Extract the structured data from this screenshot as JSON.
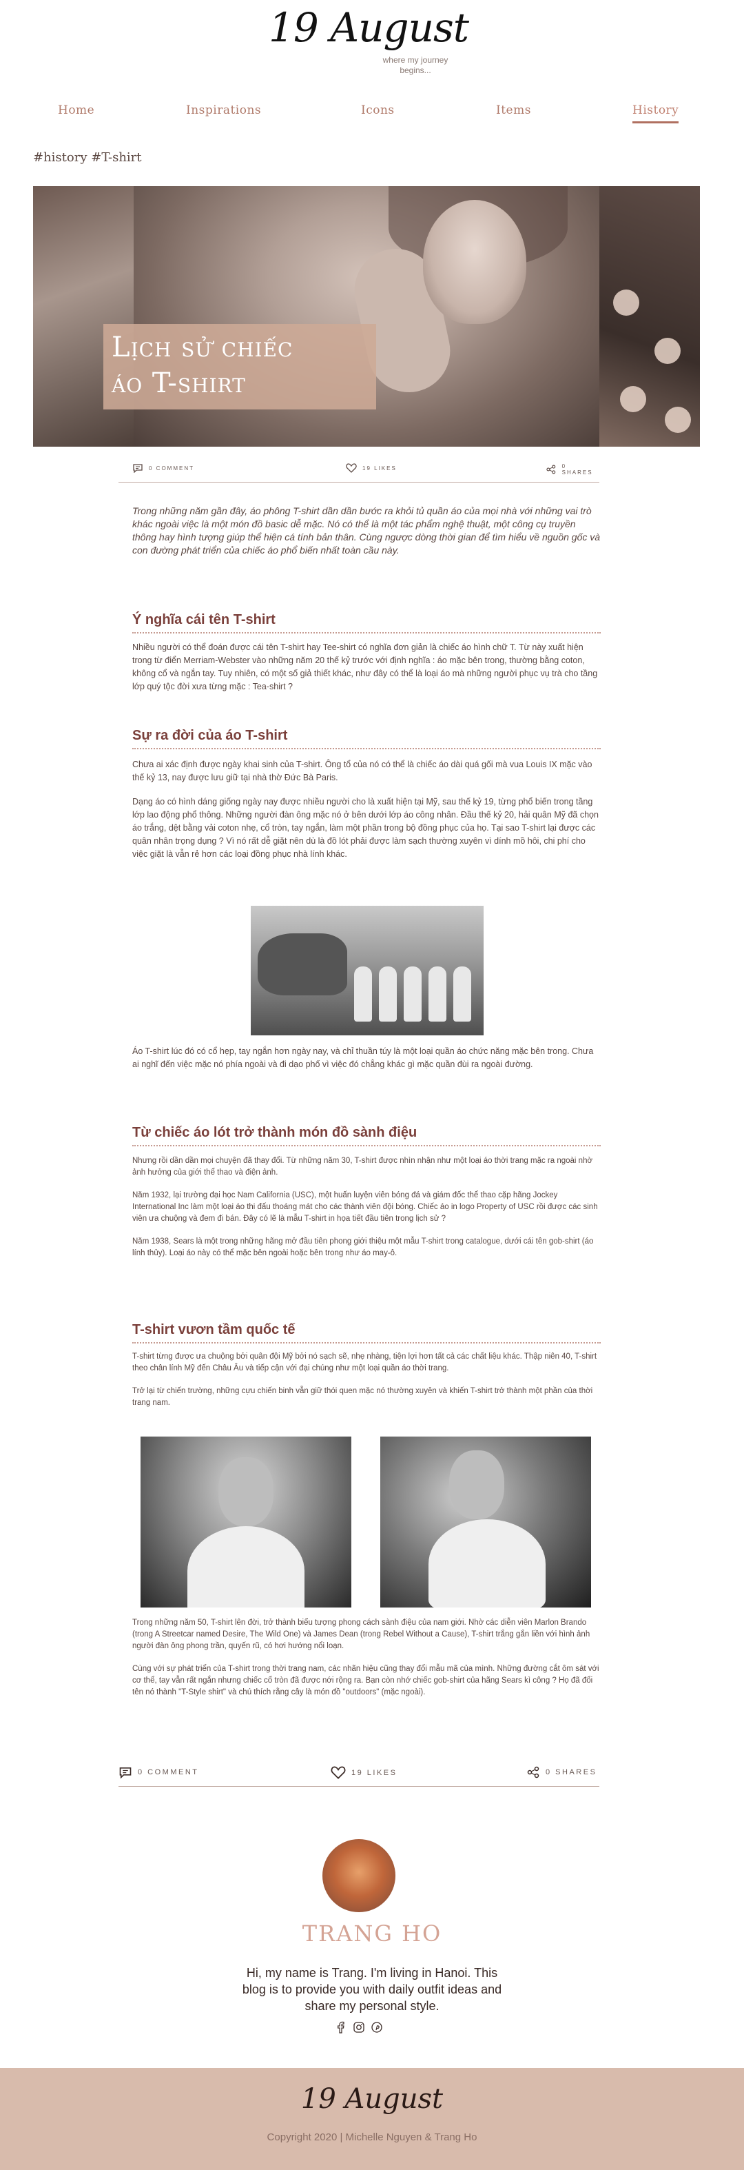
{
  "header": {
    "logo": "19 August",
    "tagline": "where my journey begins..."
  },
  "nav": {
    "items": [
      "Home",
      "Inspirations",
      "Icons",
      "Items",
      "History"
    ],
    "active": "History"
  },
  "tags": "#history #T-shirt",
  "hero": {
    "title_line1": "Lịch sử chiếc",
    "title_line2": "áo T-shirt"
  },
  "meta": {
    "comments": "0 COMMENT",
    "likes": "19 LIKES",
    "shares": "0 SHARES"
  },
  "article": {
    "intro": "Trong những năm gần đây, áo phông T-shirt dần dần bước ra khỏi tủ quần áo của mọi nhà với những vai trò khác ngoài việc là một món đồ basic dễ mặc. Nó có thể là một tác phẩm nghệ thuật, một công cụ truyền thông hay hình tượng giúp thể hiện cá tính bản thân. Cùng ngược dòng thời gian để tìm hiểu về nguồn gốc và con đường phát triển của chiếc áo phổ biến nhất toàn cầu này.",
    "section1": {
      "heading": "Ý nghĩa cái tên T-shirt",
      "p1": "Nhiều người có thể đoán được cái tên T-shirt hay Tee-shirt có nghĩa đơn giản là chiếc áo hình chữ T. Từ này xuất hiện trong từ điển Merriam-Webster vào những năm 20 thế kỷ trước với định nghĩa : áo mặc bên trong, thường bằng coton, không cổ và ngắn tay. Tuy nhiên, có một số giả thiết khác, như đây có thể là loại áo mà những người phục vụ trà cho tầng lớp quý tộc đời xưa từng mặc : Tea-shirt ?"
    },
    "section2": {
      "heading": "Sự ra đời của áo T-shirt",
      "p1": "Chưa ai xác định được ngày khai sinh của T-shirt. Ông tổ của nó có thể là chiếc áo dài quá gối mà vua Louis IX mặc vào thế kỷ 13, nay được lưu giữ tại nhà thờ Đức Bà Paris.",
      "p2": "Dạng áo có hình dáng giống ngày nay được nhiều người cho là xuất hiện tại Mỹ, sau thế kỷ 19, từng phổ biến trong tầng lớp lao động phổ thông. Những người đàn ông mặc nó ở bên dưới lớp áo công nhân. Đầu thế kỷ 20, hải quân Mỹ đã chọn áo trắng, dệt bằng vải coton nhẹ, cổ tròn, tay ngắn, làm một phần trong bộ đồng phục của họ. Tại sao T-shirt lại được các quân nhân trọng dụng ? Vì nó rất dễ giặt nên dù là đồ lót phải được làm sạch thường xuyên vì dính mồ hôi, chi phí cho việc giặt là vẫn rẻ hơn các loại đồng phục nhà lính khác.",
      "p3": "Áo T-shirt lúc đó có cổ hẹp, tay ngắn hơn ngày nay, và chỉ thuần túy là một loại quần áo chức năng mặc bên trong. Chưa ai nghĩ đến việc mặc nó phía ngoài và đi dạo phố vì việc đó chẳng khác gì mặc quần đùi ra ngoài đường."
    },
    "section3": {
      "heading": "Từ chiếc áo lót trở thành món đồ sành điệu",
      "p1": "Nhưng rồi dần dần mọi chuyện đã thay đổi. Từ những năm 30, T-shirt được nhìn nhận như một loại áo thời trang mặc ra ngoài nhờ ảnh hưởng của giới thể thao và điện ảnh.",
      "p2": "Năm 1932, lại trường đại học Nam California (USC), một huấn luyện viên bóng đá và giám đốc thể thao cặp hãng Jockey International Inc làm một loại áo thi đấu thoáng mát cho các thành viên đội bóng. Chiếc áo in logo Property of USC rồi được các sinh viên ưa chuộng và đem đi bán. Đây có lẽ là mẫu T-shirt in họa tiết đầu tiên trong lịch sử ?",
      "p3": "Năm 1938, Sears là một trong những hãng mở đầu tiên phong giới thiệu một mẫu T-shirt trong catalogue, dưới cái tên gob-shirt (áo lính thủy). Loại áo này có thể mặc bên ngoài hoặc bên trong như áo may-ô."
    },
    "section4": {
      "heading": "T-shirt vươn tầm quốc tế",
      "p1": "T-shirt từng được ưa chuộng bởi quân đội Mỹ bởi nó sạch sẽ, nhẹ nhàng, tiện lợi hơn tất cả các chất liệu khác. Thập niên 40, T-shirt theo chân lính Mỹ đến Châu Âu và tiếp cận với đại chúng như một loại quần áo thời trang.",
      "p2": "Trở lại từ chiến trường, những cựu chiến binh vẫn giữ thói quen mặc nó thường xuyên và khiến T-shirt trở thành một phần của thời trang nam.",
      "p3": "Trong những năm 50, T-shirt lên đời, trở thành biểu tượng phong cách sành điệu của nam giới. Nhờ các diễn viên Marlon Brando (trong A Streetcar named Desire, The Wild One) và James Dean (trong Rebel Without a Cause), T-shirt trắng gắn liền với hình ảnh người đàn ông phong trần, quyến rũ, có hơi hướng nổi loạn.",
      "p4": "Cùng với sự phát triển của T-shirt trong thời trang nam, các nhãn hiệu cũng thay đổi mẫu mã của mình. Những đường cắt ôm sát với cơ thể, tay vẫn rất ngắn nhưng chiếc cổ tròn đã được nới rộng ra. Bạn còn nhớ chiếc gob-shirt của hãng Sears kì công ? Họ đã đổi tên nó thành \"T-Style shirt\" và chú thích rằng cây là món đồ \"outdoors\" (mặc ngoài)."
    }
  },
  "author": {
    "name": "TRANG HO",
    "bio": "Hi, my name is Trang. I'm living in Hanoi. This blog is to provide you with daily outfit ideas and share my personal style."
  },
  "footer": {
    "logo": "19 August",
    "copyright": "Copyright 2020 | Michelle Nguyen & Trang Ho"
  }
}
